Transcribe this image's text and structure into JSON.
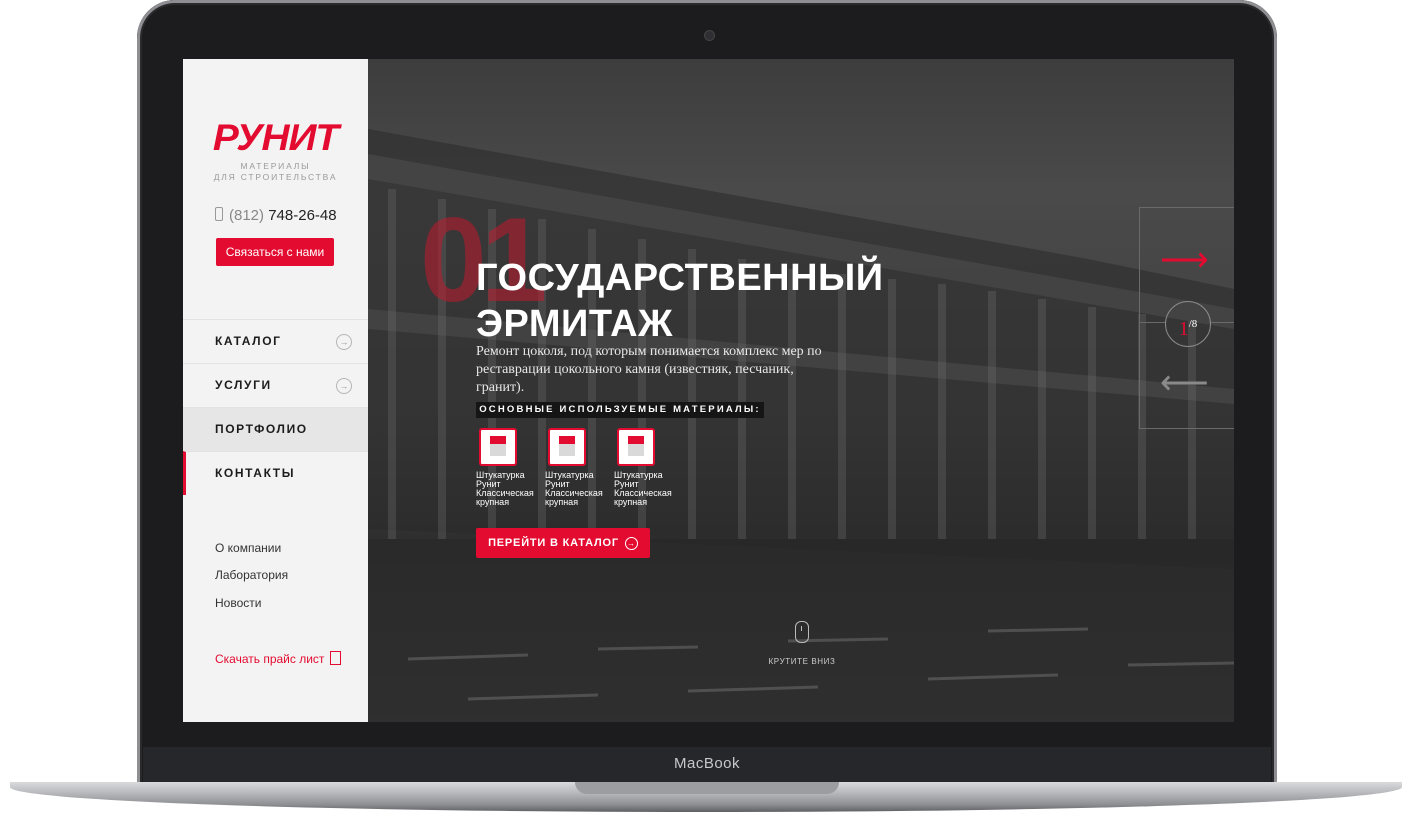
{
  "device": {
    "brand": "MacBook"
  },
  "sidebar": {
    "logo": "РУНИТ",
    "tagline": [
      "МАТЕРИАЛЫ",
      "ДЛЯ СТРОИТЕЛЬСТВА"
    ],
    "phone_code": "(812)",
    "phone_number": "748-26-48",
    "contact_button": "Связаться с нами",
    "nav": [
      {
        "label": "КАТАЛОГ"
      },
      {
        "label": "УСЛУГИ"
      },
      {
        "label": "ПОРТФОЛИО"
      },
      {
        "label": "КОНТАКТЫ"
      }
    ],
    "links": [
      "О компании",
      "Лаборатория",
      "Новости"
    ],
    "price_link": "Скачать прайс лист"
  },
  "hero": {
    "number": "01",
    "title_line1": "ГОСУДАРСТВЕННЫЙ",
    "title_line2": "ЭРМИТАЖ",
    "description": "Ремонт цоколя, под которым понимается комплекс мер по реставрации цокольного камня (известняк, песчаник, гранит).",
    "materials_title": "ОСНОВНЫЕ ИСПОЛЬЗУЕМЫЕ МАТЕРИАЛЫ:",
    "materials": [
      {
        "l1": "Штукатурка",
        "l2": "Рунит",
        "l3": "Классическая",
        "l4": "крупная"
      },
      {
        "l1": "Штукатурка",
        "l2": "Рунит",
        "l3": "Классическая",
        "l4": "крупная"
      },
      {
        "l1": "Штукатурка",
        "l2": "Рунит",
        "l3": "Классическая",
        "l4": "крупная"
      }
    ],
    "cta": "ПЕРЕЙТИ В КАТАЛОГ",
    "scroll_hint": "КРУТИТЕ ВНИЗ"
  },
  "slider": {
    "current": "1",
    "total": "/8"
  },
  "colors": {
    "accent": "#e30b2f",
    "sidebar_bg": "#f3f3f3",
    "hero_bg": "#3d3d3d"
  }
}
